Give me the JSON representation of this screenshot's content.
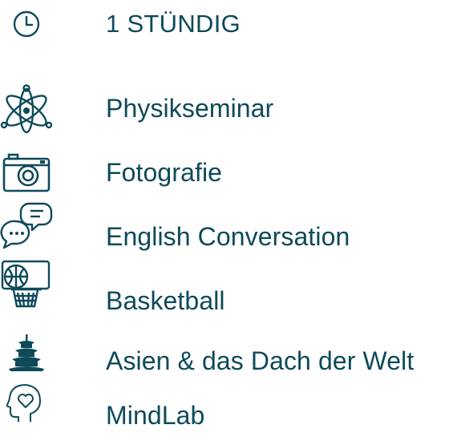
{
  "header": {
    "title": "1 STÜNDIG",
    "icon": "clock-icon"
  },
  "courses": [
    {
      "label": "Physikseminar",
      "icon": "atom-icon"
    },
    {
      "label": "Fotografie",
      "icon": "camera-icon"
    },
    {
      "label": "English Conversation",
      "icon": "speech-bubbles-icon"
    },
    {
      "label": "Basketball",
      "icon": "basketball-hoop-icon"
    },
    {
      "label": "Asien & das Dach der Welt",
      "icon": "pagoda-icon"
    },
    {
      "label": "MindLab",
      "icon": "head-heart-icon"
    }
  ],
  "colors": {
    "text": "#0e4a5a",
    "icon": "#0e4a5a"
  }
}
